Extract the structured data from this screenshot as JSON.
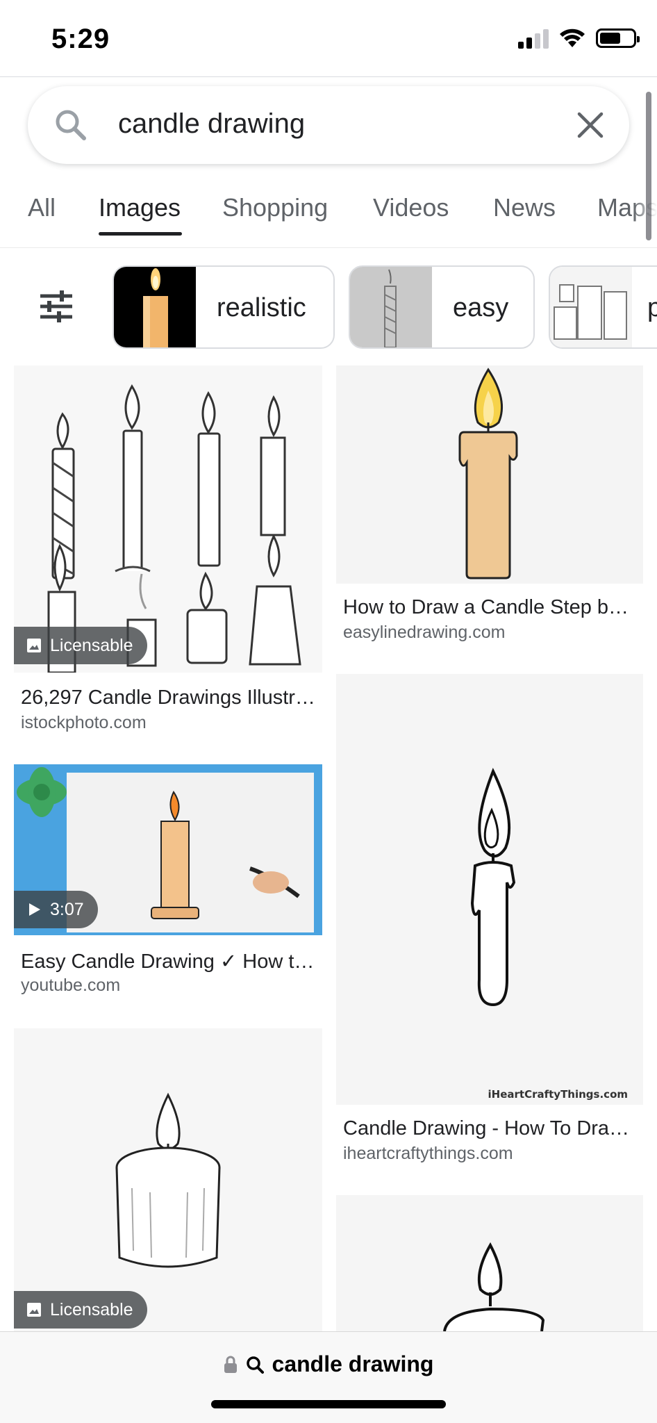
{
  "status_bar": {
    "time": "5:29"
  },
  "search": {
    "query": "candle drawing"
  },
  "tabs": [
    {
      "label": "All",
      "active": false
    },
    {
      "label": "Images",
      "active": true
    },
    {
      "label": "Shopping",
      "active": false
    },
    {
      "label": "Videos",
      "active": false
    },
    {
      "label": "News",
      "active": false
    },
    {
      "label": "Maps",
      "active": false
    }
  ],
  "chips": [
    {
      "label": "realistic"
    },
    {
      "label": "easy"
    },
    {
      "label": "p"
    }
  ],
  "results": [
    {
      "title": "26,297 Candle Drawings Illustr…",
      "source": "istockphoto.com",
      "badge": "Licensable"
    },
    {
      "title": "How to Draw a Candle Step b…",
      "source": "easylinedrawing.com"
    },
    {
      "title": "Easy Candle Drawing ✓ How t…",
      "source": "youtube.com",
      "duration": "3:07"
    },
    {
      "title": "Candle Drawing - How To Dra…",
      "source": "iheartcraftythings.com",
      "watermark": "iHeartCraftyThings.com"
    },
    {
      "badge": "Licensable"
    }
  ],
  "bottom_bar": {
    "url_text": "candle drawing"
  },
  "colors": {
    "accent": "#202124",
    "secondary_text": "#5f6368",
    "youtube_bg": "#4aa3e0"
  }
}
